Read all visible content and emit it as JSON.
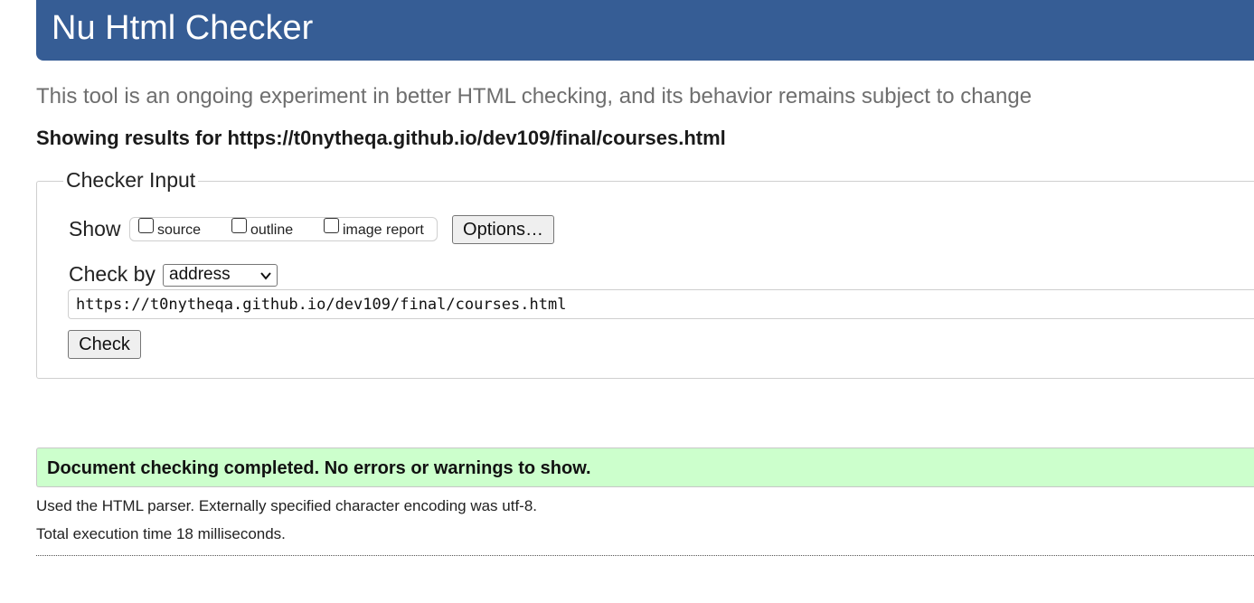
{
  "header": {
    "title": "Nu Html Checker",
    "background_color": "#365d95"
  },
  "tagline": "This tool is an ongoing experiment in better HTML checking, and its behavior remains subject to change",
  "results_for": "Showing results for https://t0nytheqa.github.io/dev109/final/courses.html",
  "checker_input": {
    "legend": "Checker Input",
    "show_label": "Show",
    "show_options": [
      {
        "label": "source",
        "checked": false
      },
      {
        "label": "outline",
        "checked": false
      },
      {
        "label": "image report",
        "checked": false
      }
    ],
    "options_button": "Options…",
    "check_by_label": "Check by",
    "check_by_selected": "address",
    "url_value": "https://t0nytheqa.github.io/dev109/final/courses.html",
    "check_button": "Check"
  },
  "result": {
    "message": "Document checking completed. No errors or warnings to show.",
    "success_color": "#ccffcc"
  },
  "details": {
    "parser_info": "Used the HTML parser. Externally specified character encoding was utf-8.",
    "execution_time": "Total execution time 18 milliseconds."
  }
}
